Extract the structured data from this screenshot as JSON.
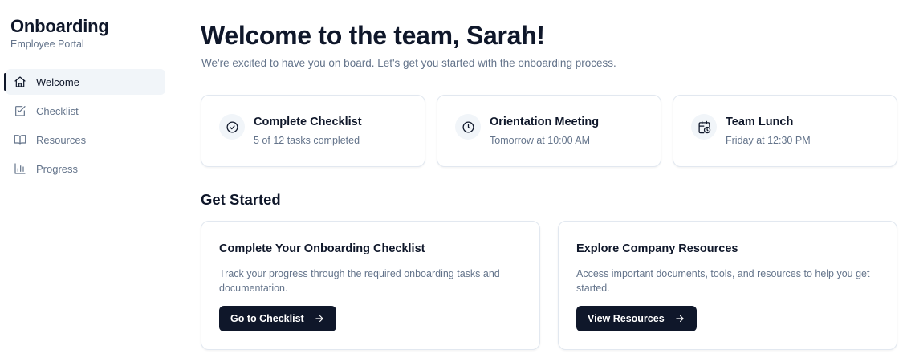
{
  "sidebar": {
    "title": "Onboarding",
    "subtitle": "Employee Portal",
    "items": [
      {
        "label": "Welcome",
        "icon": "home-icon",
        "active": true
      },
      {
        "label": "Checklist",
        "icon": "checklist-icon",
        "active": false
      },
      {
        "label": "Resources",
        "icon": "book-icon",
        "active": false
      },
      {
        "label": "Progress",
        "icon": "bar-chart-icon",
        "active": false
      }
    ]
  },
  "main": {
    "heading": "Welcome to the team, Sarah!",
    "lead": "We're excited to have you on board. Let's get you started with the onboarding process.",
    "stats": [
      {
        "title": "Complete Checklist",
        "subtitle": "5 of 12 tasks completed",
        "icon": "check-circle-icon"
      },
      {
        "title": "Orientation Meeting",
        "subtitle": "Tomorrow at 10:00 AM",
        "icon": "clock-icon"
      },
      {
        "title": "Team Lunch",
        "subtitle": "Friday at 12:30 PM",
        "icon": "calendar-clock-icon"
      }
    ],
    "section_title": "Get Started",
    "cards": [
      {
        "title": "Complete Your Onboarding Checklist",
        "description": "Track your progress through the required onboarding tasks and documentation.",
        "button": "Go to Checklist"
      },
      {
        "title": "Explore Company Resources",
        "description": "Access important documents, tools, and resources to help you get started.",
        "button": "View Resources"
      }
    ]
  },
  "colors": {
    "primary": "#0f172a",
    "muted_text": "#64748b",
    "border": "#e2e8f0",
    "active_bg": "#f1f5f9"
  }
}
